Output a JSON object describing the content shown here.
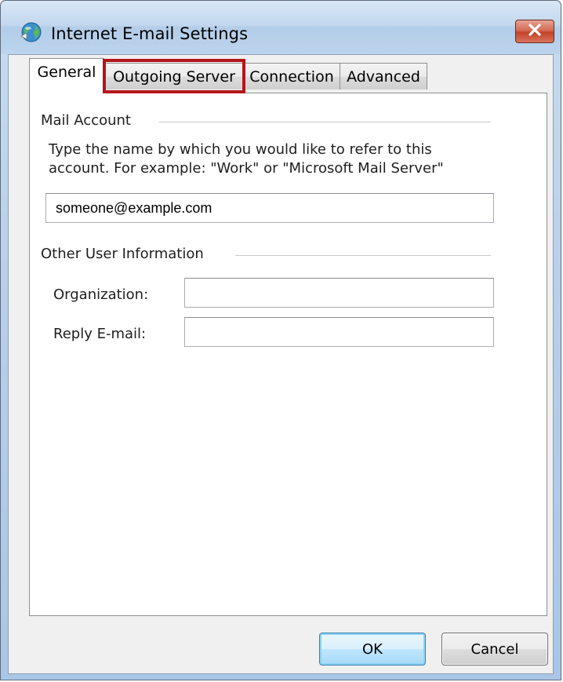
{
  "window": {
    "title": "Internet E-mail Settings",
    "app_icon": "globe-mail-icon",
    "close_icon": "close-icon"
  },
  "tabs": [
    {
      "label": "General",
      "active": true
    },
    {
      "label": "Outgoing Server",
      "active": false,
      "highlighted": true
    },
    {
      "label": "Connection",
      "active": false
    },
    {
      "label": "Advanced",
      "active": false
    }
  ],
  "mail_account": {
    "group_label": "Mail Account",
    "description_line1": "Type the name by which you would like to refer to this",
    "description_line2": "account.  For example: \"Work\" or \"Microsoft Mail Server\"",
    "account_name_value": "someone@example.com"
  },
  "other_user_info": {
    "group_label": "Other User Information",
    "organization_label": "Organization:",
    "organization_value": "",
    "reply_email_label": "Reply E-mail:",
    "reply_email_value": ""
  },
  "buttons": {
    "ok_label": "OK",
    "cancel_label": "Cancel"
  },
  "colors": {
    "highlight": "#b3151c",
    "close_button": "#c2432a"
  }
}
